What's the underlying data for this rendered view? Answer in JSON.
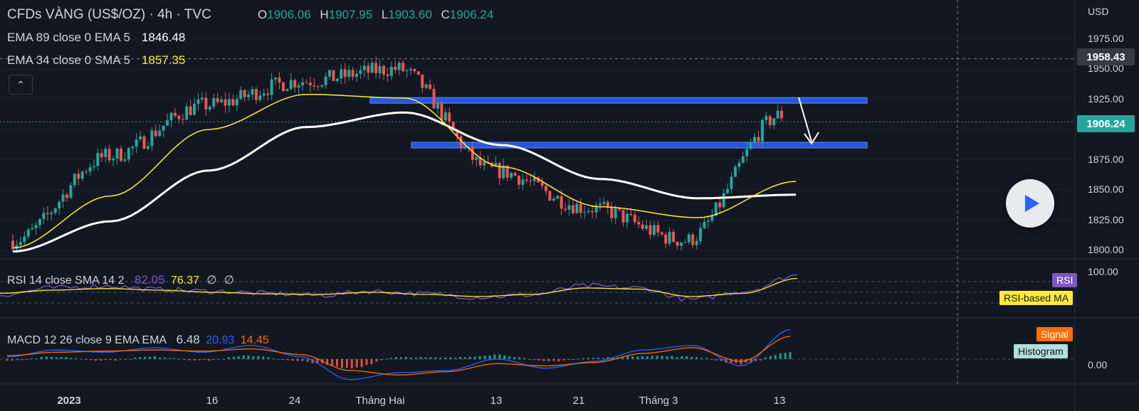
{
  "header": {
    "title": "CFDs VÀNG (US$/OZ) · 4h · TVC",
    "ohlc": [
      {
        "key": "O",
        "value": "1906.06"
      },
      {
        "key": "H",
        "value": "1907.95"
      },
      {
        "key": "L",
        "value": "1903.60"
      },
      {
        "key": "C",
        "value": "1906.24"
      }
    ]
  },
  "indicators": {
    "ema89": {
      "label": "EMA 89 close 0 EMA 5",
      "value": "1846.48",
      "color": "#ffffff"
    },
    "ema34": {
      "label": "EMA 34 close 0 SMA 5",
      "value": "1857.35",
      "color": "#ffeb3b"
    },
    "rsi": {
      "label": "RSI 14 close SMA 14 2",
      "value1": "82.05",
      "value2": "76.37",
      "extra1": "∅",
      "extra2": "∅",
      "badge": "RSI",
      "ma_badge": "RSI-based MA",
      "axis_value": "100.00"
    },
    "macd": {
      "label": "MACD 12 26 close 9 EMA EMA",
      "value1": "6.48",
      "value2": "20.93",
      "value3": "14.45",
      "signal_badge": "Signal",
      "hist_badge": "Histogram",
      "axis_value": "0.00"
    }
  },
  "price_axis": {
    "currency": "USD",
    "ticks": [
      "1975.00",
      "1950.00",
      "1925.00",
      "1900.00",
      "1875.00",
      "1850.00",
      "1825.00",
      "1800.00"
    ],
    "crosshair_price": "1958.43",
    "last_price": "1906.24"
  },
  "time_axis": {
    "labels": [
      "2023",
      "16",
      "24",
      "Tháng Hai",
      "13",
      "21",
      "Tháng 3",
      "13"
    ]
  },
  "colors": {
    "up": "#26a69a",
    "down": "#ef5350",
    "zone": "#2962ff",
    "rsi": "#7e57c2",
    "macd": "#2962ff",
    "signal": "#ff6d00"
  },
  "icons": {
    "collapse": "chevron-up-icon",
    "play": "play-icon"
  },
  "chart_data": {
    "type": "line",
    "title": "CFDs VÀNG (US$/OZ) · 4h · TVC",
    "xlabel": "",
    "ylabel": "USD",
    "ylim": [
      1790,
      1990
    ],
    "x": [
      "2023-01-02",
      "2023-01-09",
      "2023-01-16",
      "2023-01-24",
      "2023-02-01",
      "2023-02-13",
      "2023-02-21",
      "2023-03-01",
      "2023-03-13"
    ],
    "series": [
      {
        "name": "CFDs VÀNG (US$/OZ)",
        "values": [
          1808,
          1878,
          1920,
          1940,
          1950,
          1866,
          1835,
          1808,
          1912
        ]
      },
      {
        "name": "EMA 89 close 0 EMA 5",
        "values": [
          1799,
          1824,
          1866,
          1902,
          1914,
          1887,
          1859,
          1843,
          1846
        ]
      },
      {
        "name": "EMA 34 close 0 SMA 5",
        "values": [
          1802,
          1845,
          1900,
          1929,
          1926,
          1869,
          1836,
          1827,
          1857
        ]
      }
    ],
    "zones": [
      {
        "from": "2023-01-30",
        "to": "2023-03-15",
        "price": 1924
      },
      {
        "from": "2023-02-03",
        "to": "2023-03-15",
        "price": 1887
      }
    ],
    "rsi": [
      {
        "name": "RSI 14 close SMA 14 2",
        "last": 82.05
      },
      {
        "name": "RSI-based MA",
        "last": 76.37
      }
    ],
    "macd": [
      {
        "name": "MACD 12 26 close 9 EMA EMA",
        "last": 6.48
      },
      {
        "name": "Signal",
        "last": 20.93
      },
      {
        "name": "Histogram",
        "last": 14.45
      }
    ],
    "grid": true,
    "legend": "top-left"
  }
}
